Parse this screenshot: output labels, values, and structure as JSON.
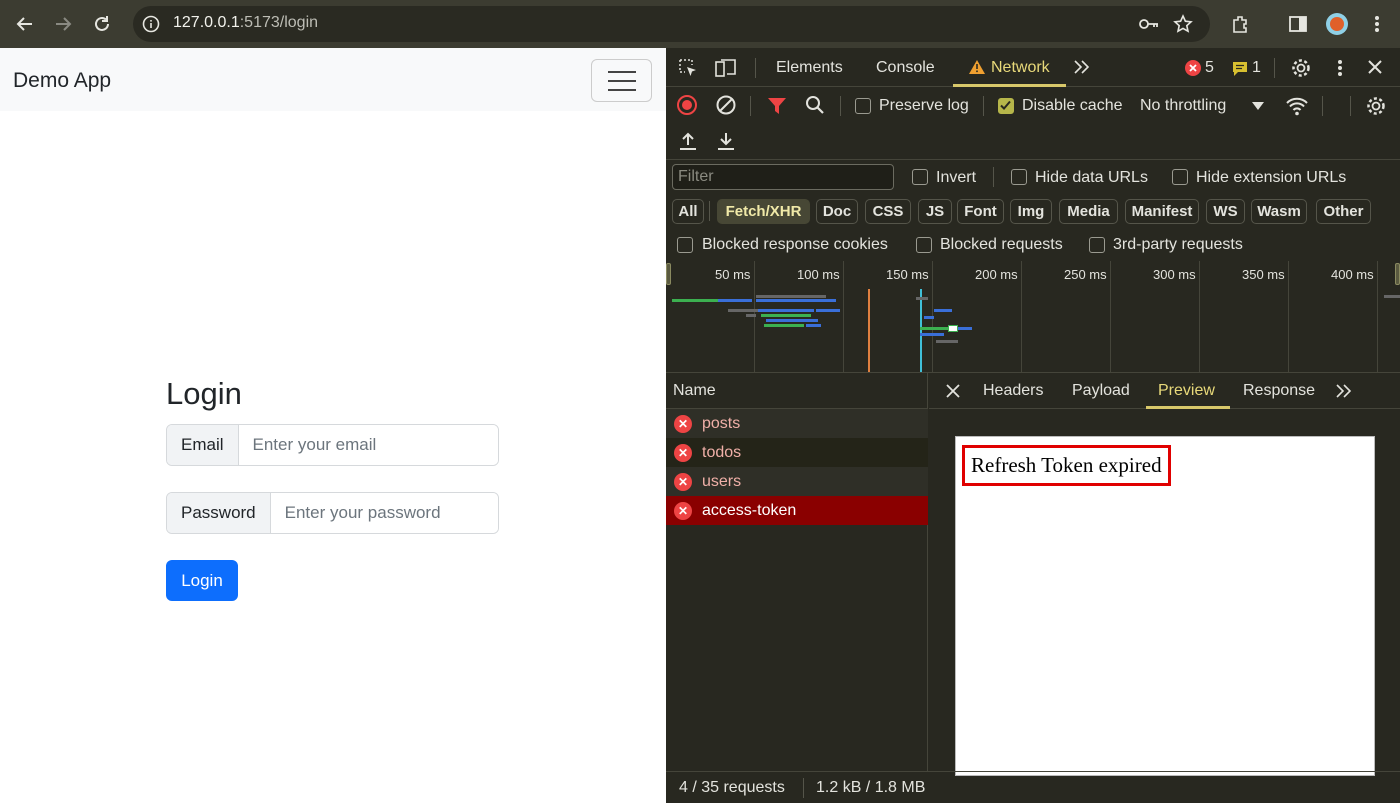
{
  "browser": {
    "url_host": "127.0.0.1",
    "url_path": ":5173/login"
  },
  "page": {
    "brand": "Demo App",
    "title": "Login",
    "email_label": "Email",
    "email_placeholder": "Enter your email",
    "password_label": "Password",
    "password_placeholder": "Enter your password",
    "login_button": "Login"
  },
  "devtools": {
    "tabs": [
      "Elements",
      "Console",
      "Network"
    ],
    "error_count": "5",
    "message_count": "1",
    "preserve_log": "Preserve log",
    "disable_cache": "Disable cache",
    "throttling": "No throttling",
    "filter_placeholder": "Filter",
    "invert": "Invert",
    "hide_data_urls": "Hide data URLs",
    "hide_extension_urls": "Hide extension URLs",
    "type_filters": [
      "All",
      "Fetch/XHR",
      "Doc",
      "CSS",
      "JS",
      "Font",
      "Img",
      "Media",
      "Manifest",
      "WS",
      "Wasm",
      "Other"
    ],
    "blocked_response_cookies": "Blocked response cookies",
    "blocked_requests": "Blocked requests",
    "third_party_requests": "3rd-party requests",
    "timeline_ticks": [
      "50 ms",
      "100 ms",
      "150 ms",
      "200 ms",
      "250 ms",
      "300 ms",
      "350 ms",
      "400 ms"
    ],
    "name_header": "Name",
    "requests": [
      "posts",
      "todos",
      "users",
      "access-token"
    ],
    "detail_tabs": [
      "Headers",
      "Payload",
      "Preview",
      "Response"
    ],
    "preview_text": "Refresh Token expired",
    "status_requests": "4 / 35 requests",
    "status_size": "1.2 kB / 1.8 MB"
  },
  "colors": {
    "accent": "#0d6efd",
    "error": "#e44444",
    "selected_row": "#8a0000"
  }
}
